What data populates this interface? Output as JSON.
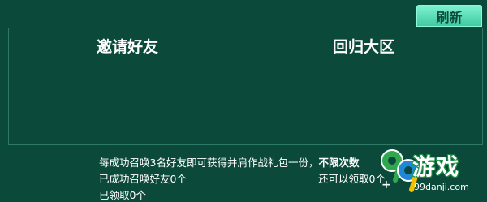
{
  "toolbar": {
    "refresh_label": "刷新"
  },
  "table": {
    "columns": [
      "邀请好友",
      "回归大区"
    ]
  },
  "info": {
    "reward_text": "每成功召唤3名好友即可获得并肩作战礼包一份，",
    "reward_emphasis": "不限次数",
    "summoned_text": "已成功召唤好友0个",
    "remaining_text": "还可以领取0个",
    "claimed_text": "已领取0个"
  },
  "watermark": {
    "digits": "99",
    "brand": "游戏",
    "url": "99danji.com",
    "colors": {
      "green": "#2fa84f",
      "blue": "#1e88d8",
      "yellow": "#f2c200"
    }
  }
}
